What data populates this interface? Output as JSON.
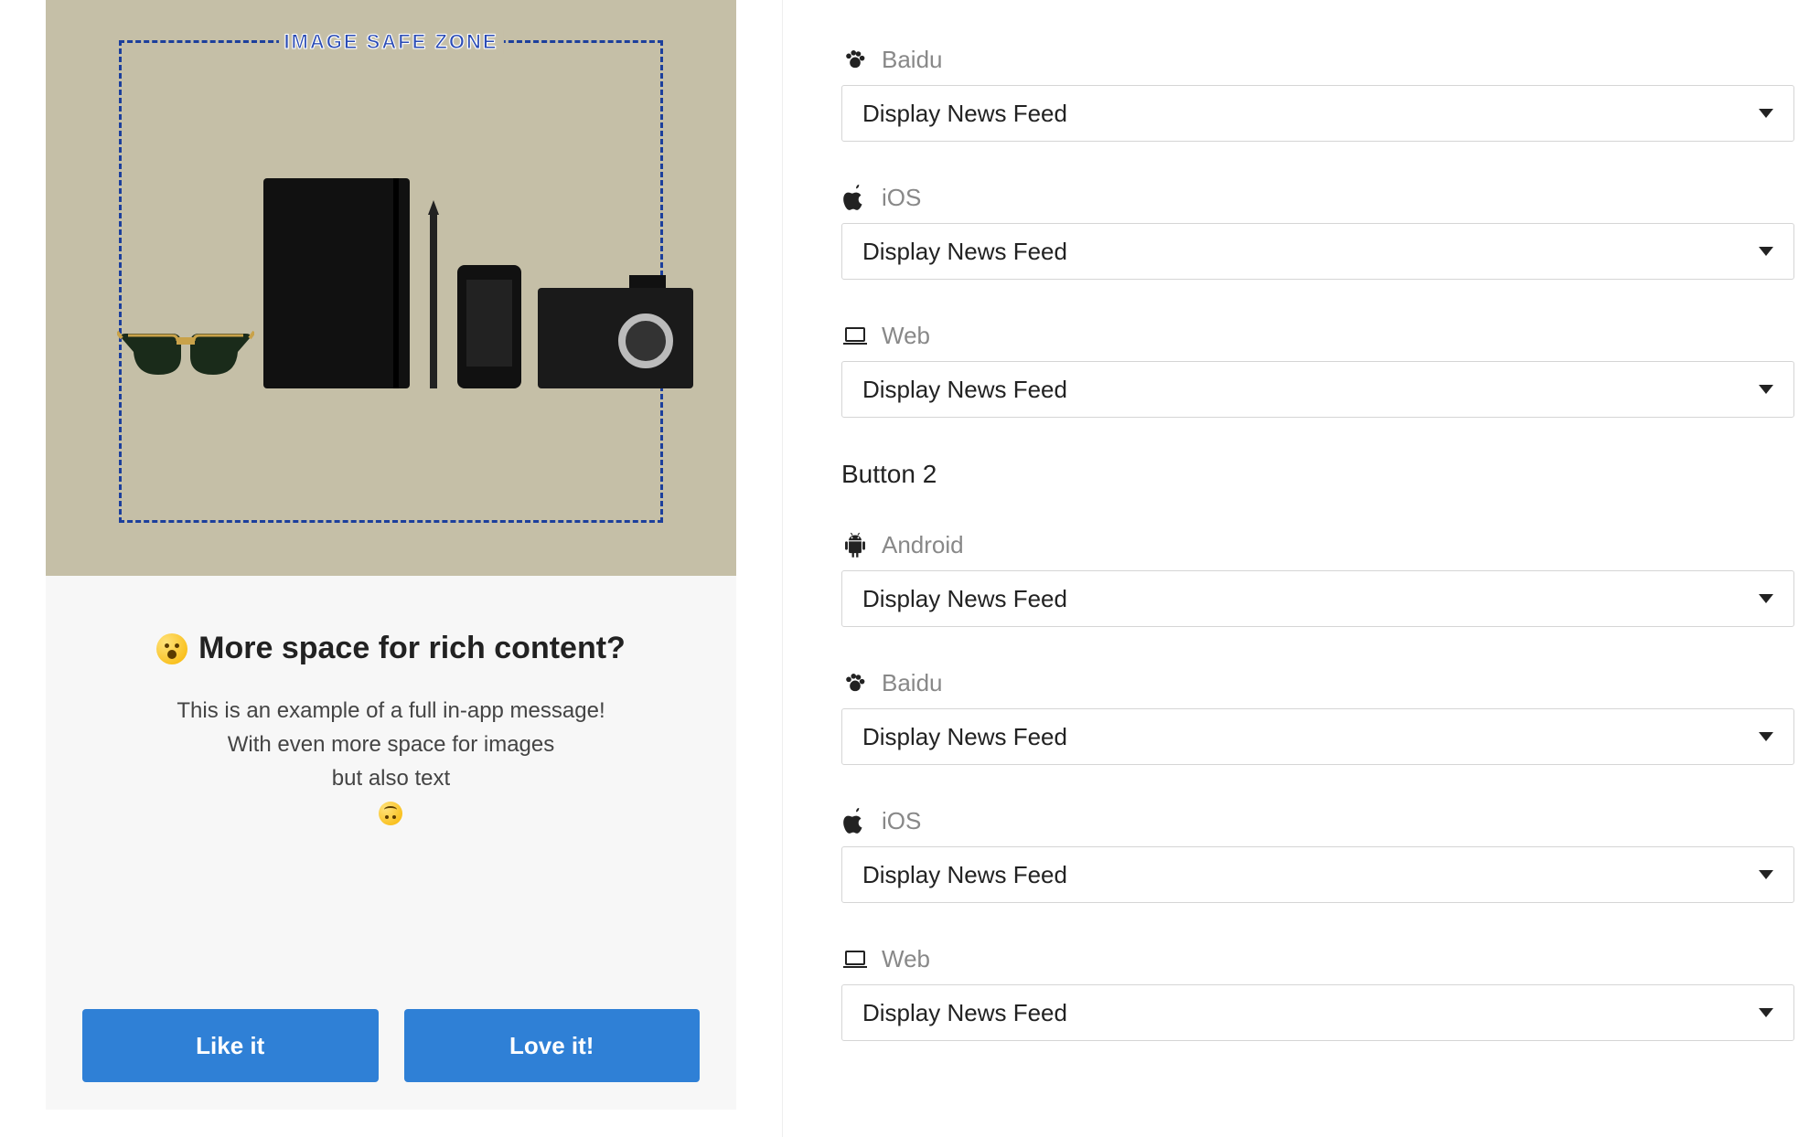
{
  "preview": {
    "safe_zone_label": "IMAGE SAFE ZONE",
    "headline": "More space for rich content?",
    "body_line1": "This is an example of a full in-app message!",
    "body_line2": "With even more space for images",
    "body_line3": "but also text",
    "button1_label": "Like it",
    "button2_label": "Love it!"
  },
  "form": {
    "button1": {
      "platforms": [
        {
          "icon": "paw",
          "label": "Baidu",
          "value": "Display News Feed"
        },
        {
          "icon": "apple",
          "label": "iOS",
          "value": "Display News Feed"
        },
        {
          "icon": "laptop",
          "label": "Web",
          "value": "Display News Feed"
        }
      ]
    },
    "section2_heading": "Button 2",
    "button2": {
      "platforms": [
        {
          "icon": "android",
          "label": "Android",
          "value": "Display News Feed"
        },
        {
          "icon": "paw",
          "label": "Baidu",
          "value": "Display News Feed"
        },
        {
          "icon": "apple",
          "label": "iOS",
          "value": "Display News Feed"
        },
        {
          "icon": "laptop",
          "label": "Web",
          "value": "Display News Feed"
        }
      ]
    }
  }
}
